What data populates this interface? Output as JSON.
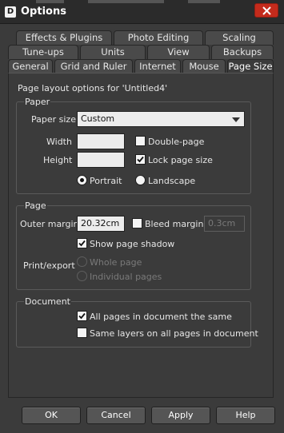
{
  "window": {
    "logo_letter": "D",
    "title": "Options"
  },
  "tabs": {
    "row1": [
      "Effects & Plugins",
      "Photo Editing",
      "Scaling"
    ],
    "row2": [
      "Tune-ups",
      "Units",
      "View",
      "Backups"
    ],
    "row3": [
      "General",
      "Grid and Ruler",
      "Internet",
      "Mouse",
      "Page Size"
    ],
    "active": "Page Size"
  },
  "page": {
    "description": "Page layout options for 'Untitled4'"
  },
  "paper": {
    "group_label": "Paper",
    "size_label": "Paper size",
    "size_value": "Custom",
    "width_label": "Width",
    "width_value": "",
    "height_label": "Height",
    "height_value": "",
    "double_page_label": "Double-page",
    "double_page_checked": false,
    "lock_size_label": "Lock page size",
    "lock_size_checked": true,
    "portrait_label": "Portrait",
    "landscape_label": "Landscape",
    "orientation": "Portrait"
  },
  "page_section": {
    "group_label": "Page",
    "outer_margin_label": "Outer margin",
    "outer_margin_value": "20.32cm",
    "bleed_margin_label": "Bleed margin",
    "bleed_margin_checked": false,
    "bleed_margin_value": "0.3cm",
    "show_shadow_label": "Show page shadow",
    "show_shadow_checked": true,
    "print_export_label": "Print/export",
    "whole_page_label": "Whole page",
    "individual_pages_label": "Individual pages"
  },
  "document": {
    "group_label": "Document",
    "all_pages_same_label": "All pages in document the same",
    "all_pages_same_checked": true,
    "same_layers_label": "Same layers on all pages in document",
    "same_layers_checked": false
  },
  "buttons": {
    "ok": "OK",
    "cancel": "Cancel",
    "apply": "Apply",
    "help": "Help"
  },
  "colors": {
    "background": "#3b3b3b",
    "titlebar": "#2b2b2b",
    "close_button": "#c42b1c"
  }
}
